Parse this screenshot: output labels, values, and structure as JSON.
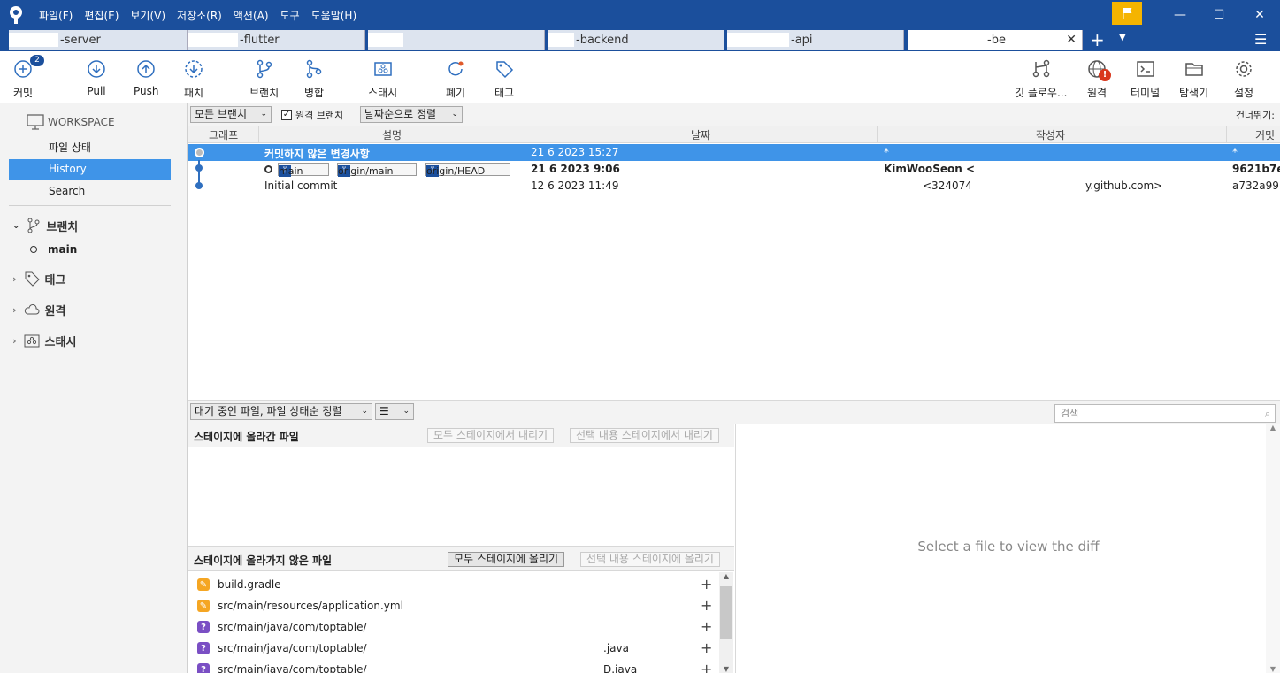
{
  "menu": [
    "파일(F)",
    "편집(E)",
    "보기(V)",
    "저장소(R)",
    "액션(A)",
    "도구",
    "도움말(H)"
  ],
  "tabs": [
    "-server",
    "-flutter",
    "",
    "-backend",
    "-api",
    "-be"
  ],
  "toolbar": {
    "commit": "커밋",
    "commit_badge": "2",
    "pull": "Pull",
    "push": "Push",
    "fetch": "패치",
    "branch": "브랜치",
    "merge": "병합",
    "stash": "스태시",
    "discard": "폐기",
    "tag": "태그",
    "gitflow": "깃 플로우...",
    "remote": "원격",
    "terminal": "터미널",
    "explorer": "탐색기",
    "settings": "설정"
  },
  "sidebar": {
    "workspace": "WORKSPACE",
    "items": [
      "파일 상태",
      "History",
      "Search"
    ],
    "branches": "브랜치",
    "branch_main": "main",
    "tags": "태그",
    "remotes": "원격",
    "stashes": "스태시"
  },
  "filter": {
    "branches": "모든 브랜치",
    "remote_branches": "원격 브랜치",
    "sort": "날짜순으로 정렬",
    "jump": "건너뛰기:"
  },
  "columns": {
    "graph": "그래프",
    "desc": "설명",
    "date": "날짜",
    "author": "작성자",
    "commit": "커밋"
  },
  "commits": [
    {
      "desc": "커밋하지 않은 변경사항",
      "date": "21 6 2023 15:27",
      "author": "*",
      "hash": "*"
    },
    {
      "desc": "",
      "date": "21 6 2023 9:06",
      "author": "KimWooSeon <",
      "hash": "9621b7e",
      "refs": [
        "main",
        "origin/main",
        "origin/HEAD"
      ]
    },
    {
      "desc": "Initial commit",
      "date": "12 6 2023 11:49",
      "author": "<324074",
      "author2": "y.github.com>",
      "hash": "a732a99"
    }
  ],
  "pending": {
    "sort": "대기 중인 파일, 파일 상태순 정렬",
    "search_placeholder": "검색"
  },
  "staged": {
    "title": "스테이지에 올라간 파일",
    "unstage_all": "모두 스테이지에서 내리기",
    "unstage_sel": "선택 내용 스테이지에서 내리기"
  },
  "unstaged": {
    "title": "스테이지에 올라가지 않은 파일",
    "stage_all": "모두 스테이지에 올리기",
    "stage_sel": "선택 내용 스테이지에 올리기"
  },
  "files": [
    {
      "name": "build.gradle",
      "status": "modified",
      "suffix": ""
    },
    {
      "name": "src/main/resources/application.yml",
      "status": "modified",
      "suffix": ""
    },
    {
      "name": "src/main/java/com/toptable/",
      "status": "untracked",
      "suffix": ""
    },
    {
      "name": "src/main/java/com/toptable/",
      "status": "untracked",
      "suffix": ".java"
    },
    {
      "name": "src/main/java/com/toptable/",
      "status": "untracked",
      "suffix": "D.java"
    }
  ],
  "diff_placeholder": "Select a file to view the diff",
  "colors": {
    "titlebar": "#1b4f9c",
    "selection": "#3f94e8",
    "modified": "#f5a623",
    "untracked": "#7a4fc4"
  }
}
